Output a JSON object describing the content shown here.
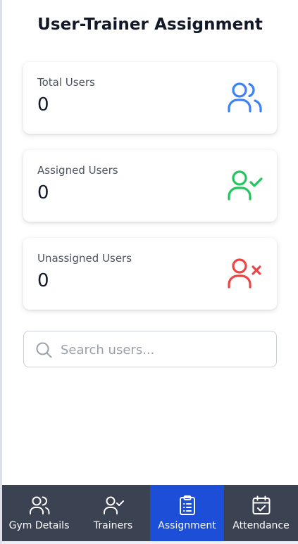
{
  "page": {
    "title": "User-Trainer Assignment"
  },
  "stats": [
    {
      "label": "Total Users",
      "value": "0",
      "icon": "users-icon",
      "color": "#3b82f6"
    },
    {
      "label": "Assigned Users",
      "value": "0",
      "icon": "user-check-icon",
      "color": "#22c55e"
    },
    {
      "label": "Unassigned Users",
      "value": "0",
      "icon": "user-x-icon",
      "color": "#ef4444"
    }
  ],
  "search": {
    "placeholder": "Search users...",
    "value": ""
  },
  "nav": {
    "background": "#3b4252",
    "active_color": "#1d4ed8",
    "items": [
      {
        "label": "Gym Details",
        "icon": "users-icon",
        "active": false
      },
      {
        "label": "Trainers",
        "icon": "user-check-icon",
        "active": false
      },
      {
        "label": "Assignment",
        "icon": "clipboard-list-icon",
        "active": true
      },
      {
        "label": "Attendance",
        "icon": "calendar-check-icon",
        "active": false
      }
    ]
  }
}
